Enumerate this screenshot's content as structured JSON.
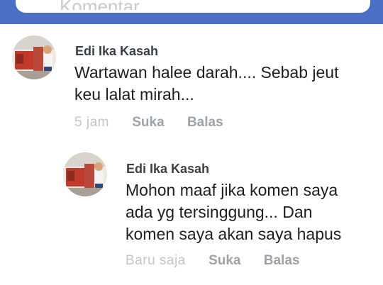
{
  "comment_input": {
    "placeholder": "Komentar"
  },
  "colors": {
    "header_blue": "#4a6fc4",
    "author": "#3b3f47",
    "text": "#1c1e21",
    "meta_action": "#9ea2a9",
    "meta_time": "#c3c5ca"
  },
  "comments": [
    {
      "author": "Edi Ika Kasah",
      "lines": [
        "Wartawan halee darah.... Sebab jeut",
        "keu lalat mirah..."
      ],
      "time": "5 jam",
      "like_label": "Suka",
      "reply_label": "Balas"
    },
    {
      "author": "Edi Ika Kasah",
      "lines": [
        "Mohon maaf jika komen saya",
        "ada yg tersinggung... Dan",
        "komen saya akan saya hapus"
      ],
      "time": "Baru saja",
      "like_label": "Suka",
      "reply_label": "Balas"
    }
  ]
}
